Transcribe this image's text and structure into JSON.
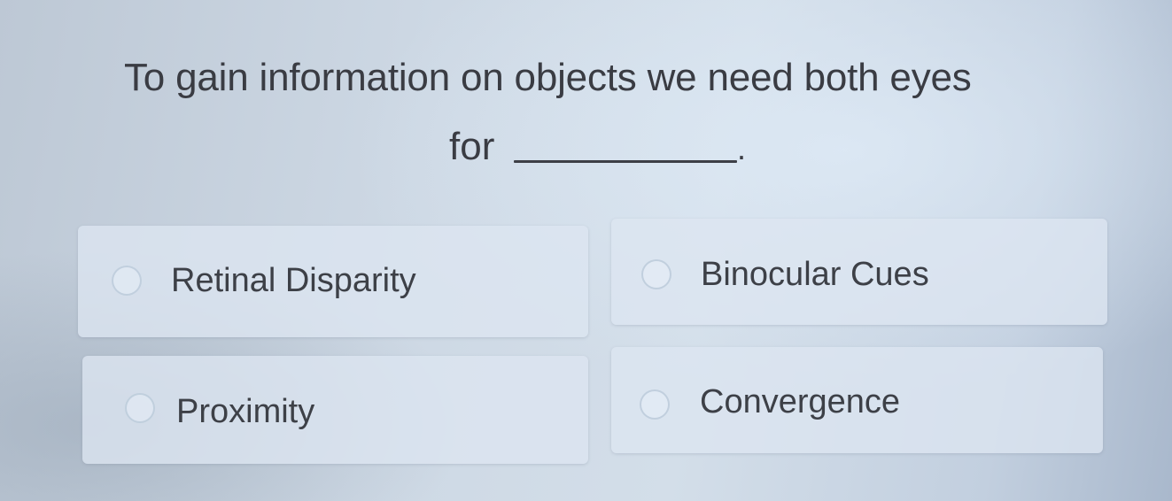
{
  "question": {
    "line1": "To gain information on objects we need both eyes",
    "line2": "for",
    "period": "."
  },
  "options": [
    {
      "label": "Retinal Disparity",
      "selected": false
    },
    {
      "label": "Binocular Cues",
      "selected": false
    },
    {
      "label": "Proximity",
      "selected": false
    },
    {
      "label": "Convergence",
      "selected": false
    }
  ],
  "colors": {
    "text": "#3a3c43",
    "option_background": "#dce6f1",
    "page_background": "#cdd8e4"
  }
}
